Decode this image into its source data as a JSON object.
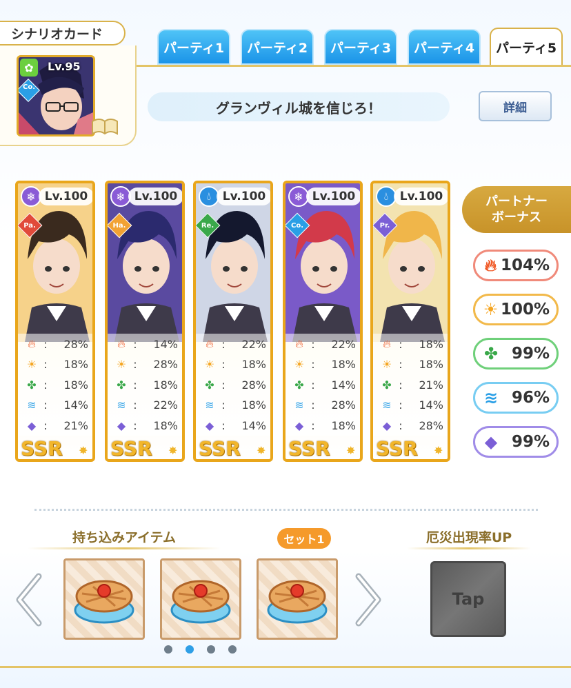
{
  "scenario": {
    "label": "シナリオカード",
    "card_level": "Lv.95",
    "card_attr": "Co."
  },
  "tabs": [
    {
      "label": "パーティ1",
      "active": false
    },
    {
      "label": "パーティ2",
      "active": false
    },
    {
      "label": "パーティ3",
      "active": false
    },
    {
      "label": "パーティ4",
      "active": false
    },
    {
      "label": "パーティ5",
      "active": true
    }
  ],
  "title": "グランヴィル城を信じろ！",
  "detail_button": "詳細",
  "members": [
    {
      "level": "Lv.100",
      "attr": "Pa.",
      "element": "snowflake",
      "rarity": "SSR",
      "stats": [
        "28%",
        "18%",
        "18%",
        "14%",
        "21%"
      ]
    },
    {
      "level": "Lv.100",
      "attr": "Ha.",
      "element": "snowflake",
      "rarity": "SSR",
      "stats": [
        "14%",
        "28%",
        "18%",
        "22%",
        "18%"
      ]
    },
    {
      "level": "Lv.100",
      "attr": "Re.",
      "element": "water-drop",
      "rarity": "SSR",
      "stats": [
        "22%",
        "18%",
        "28%",
        "18%",
        "14%"
      ]
    },
    {
      "level": "Lv.100",
      "attr": "Co.",
      "element": "snowflake",
      "rarity": "SSR",
      "stats": [
        "22%",
        "18%",
        "14%",
        "28%",
        "18%"
      ]
    },
    {
      "level": "Lv.100",
      "attr": "Pr.",
      "element": "water-drop",
      "rarity": "SSR",
      "stats": [
        "18%",
        "18%",
        "21%",
        "14%",
        "28%"
      ]
    }
  ],
  "stat_icons": [
    "fire-icon",
    "sun-icon",
    "clover-icon",
    "wind-icon",
    "gem-icon"
  ],
  "partner_bonus": {
    "title_line1": "パートナー",
    "title_line2": "ボーナス",
    "values": [
      "104%",
      "100%",
      "99%",
      "96%",
      "99%"
    ]
  },
  "items_section": {
    "title": "持ち込みアイテム",
    "set_label": "セット1"
  },
  "disaster_section": {
    "title": "厄災出現率UP",
    "tap_label": "Tap"
  },
  "pagination": {
    "count": 4,
    "active": 2
  },
  "colors": {
    "fire": "#f05a28",
    "sun": "#f5a623",
    "clover": "#3aa84a",
    "wind": "#2a9fe6",
    "gem": "#7b5fd6",
    "frame_gold": "#e9a61b",
    "tab_blue": "#1b94e8"
  }
}
